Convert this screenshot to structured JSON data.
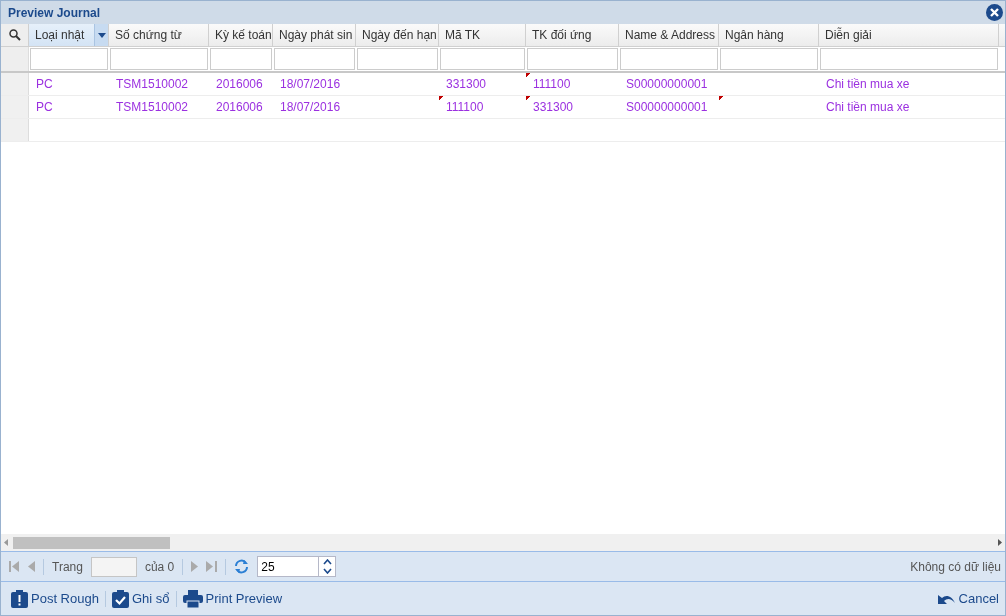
{
  "window": {
    "title": "Preview Journal"
  },
  "table": {
    "columns": [
      {
        "label": "Loại nhật",
        "selected": true
      },
      {
        "label": "Số chứng từ",
        "selected": false
      },
      {
        "label": "Kỳ kế toán",
        "selected": false
      },
      {
        "label": "Ngày phát sin",
        "selected": false
      },
      {
        "label": "Ngày đến hạn",
        "selected": false
      },
      {
        "label": "Mã TK",
        "selected": false
      },
      {
        "label": "TK đối ứng",
        "selected": false
      },
      {
        "label": "Name & Address",
        "selected": false
      },
      {
        "label": "Ngân hàng",
        "selected": false
      },
      {
        "label": "Diễn giải",
        "selected": false
      }
    ],
    "rows": [
      {
        "cells": [
          {
            "text": "PC",
            "modified": false
          },
          {
            "text": "TSM1510002",
            "modified": false
          },
          {
            "text": "2016006",
            "modified": false
          },
          {
            "text": "18/07/2016",
            "modified": false
          },
          null,
          {
            "text": "331300",
            "modified": false
          },
          {
            "text": "111100",
            "modified": true
          },
          {
            "text": "S00000000001",
            "modified": false
          },
          null,
          {
            "text": "Chi tiền mua xe",
            "modified": false
          }
        ]
      },
      {
        "cells": [
          {
            "text": "PC",
            "modified": false
          },
          {
            "text": "TSM1510002",
            "modified": false
          },
          {
            "text": "2016006",
            "modified": false
          },
          {
            "text": "18/07/2016",
            "modified": false
          },
          null,
          {
            "text": "111100",
            "modified": true
          },
          {
            "text": "331300",
            "modified": true
          },
          {
            "text": "S00000000001",
            "modified": false
          },
          {
            "text": "",
            "modified": true
          },
          {
            "text": "Chi tiền mua xe",
            "modified": false
          }
        ]
      }
    ]
  },
  "pager": {
    "page_label": "Trang",
    "of_label": "của 0",
    "page_size": "25",
    "status": "Không có dữ liệu"
  },
  "toolbar": {
    "buttons": [
      {
        "kind": "post",
        "label": "Post Rough"
      },
      {
        "kind": "check",
        "label": "Ghi sổ"
      },
      {
        "kind": "print",
        "label": "Print Preview"
      }
    ],
    "cancel": "Cancel"
  }
}
